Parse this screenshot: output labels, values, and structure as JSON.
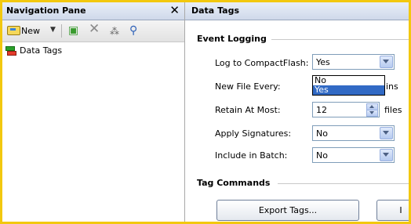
{
  "nav_pane": {
    "title": "Navigation Pane",
    "close_glyph": "✕",
    "toolbar": {
      "new_label": "New",
      "dropdown_glyph": "▼",
      "icons": [
        "new-tag-icon",
        "add-folder-icon",
        "delete-icon",
        "rename-icon",
        "search-icon"
      ]
    },
    "tree": [
      {
        "label": "Data Tags"
      }
    ]
  },
  "main": {
    "header_title": "Data Tags",
    "event_logging": {
      "title": "Event Logging",
      "log_to_cf": {
        "label": "Log to CompactFlash:",
        "value": "Yes"
      },
      "dropdown_options": [
        "No",
        "Yes"
      ],
      "dropdown_selected": "Yes",
      "new_file_every": {
        "label": "New File Every:",
        "unit_partial": "ins"
      },
      "retain_at_most": {
        "label": "Retain At Most:",
        "value": "12",
        "unit": "files"
      },
      "apply_signatures": {
        "label": "Apply Signatures:",
        "value": "No"
      },
      "include_in_batch": {
        "label": "Include in Batch:",
        "value": "No"
      }
    },
    "tag_commands": {
      "title": "Tag Commands",
      "export_label": "Export Tags...",
      "import_partial": "I"
    }
  },
  "colors": {
    "frame": "#f2c80f",
    "selection": "#316ac5",
    "header_gradient_top": "#e9eef8",
    "header_gradient_bottom": "#cfd9ea"
  }
}
